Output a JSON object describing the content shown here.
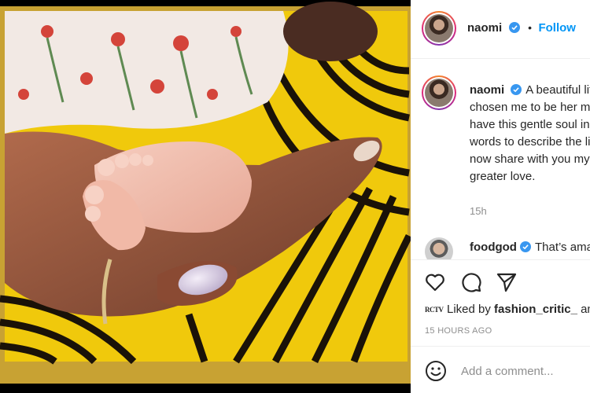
{
  "post": {
    "author": "naomi",
    "follow_label": "Follow",
    "dot": "•",
    "caption": "A beautiful little blessing has chosen me to be her mother, so honoured to have this gentle soul in my life there are no words to describe the lifelong bond that I now share with you my angel. There is no greater love.",
    "caption_time": "15h",
    "comment": {
      "author": "foodgod",
      "text": "That’s amazing"
    },
    "liked_by_prefix": "Liked by",
    "liked_by_user": "fashion_critic_",
    "liked_by_suffix": "and others",
    "liked_avatar_text": "RCTV",
    "timestamp": "15 HOURS AGO",
    "comment_placeholder": "Add a comment..."
  },
  "icons": {
    "verified": "verified-badge-icon",
    "like": "heart-icon",
    "comment": "comment-bubble-icon",
    "share": "share-arrow-icon",
    "emoji": "emoji-icon"
  },
  "colors": {
    "accent": "#0095f6",
    "text": "#262626",
    "muted": "#8e8e8e",
    "border": "#efefef"
  }
}
